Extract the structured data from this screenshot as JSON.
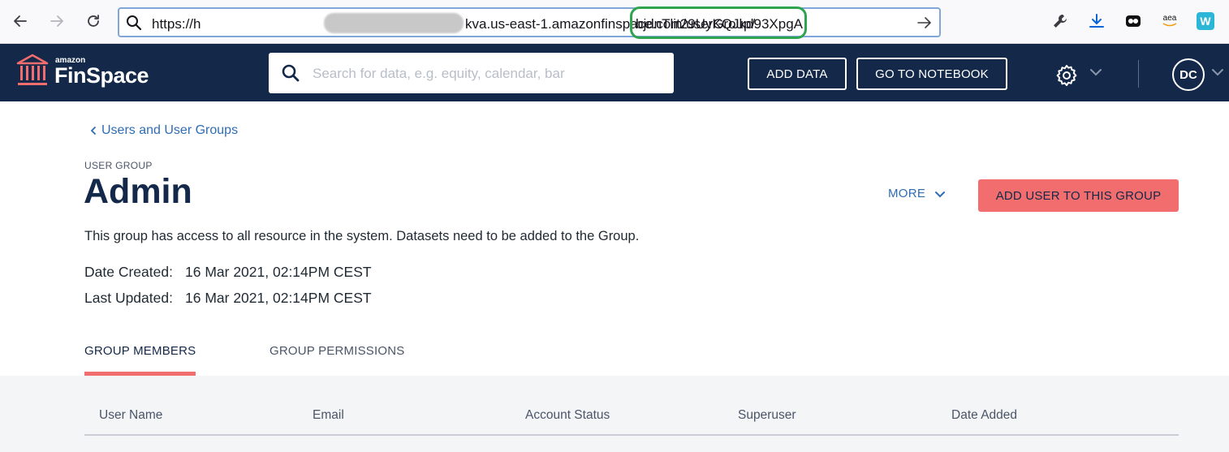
{
  "browser": {
    "url_prefix": "https://h",
    "url_middle": "kva.us-east-1.amazonfinspace.com/userGroup/",
    "url_highlight": "bjdnTlit29UyKQJkd93XpgA",
    "extensions": [
      "wrench-icon",
      "download-icon",
      "extension-icon",
      "amazon-assistant-icon",
      "w-extension-icon"
    ],
    "ext_aea_label": "aea",
    "ext_w_label": "W"
  },
  "header": {
    "logo_small": "amazon",
    "logo_big": "FinSpace",
    "search_placeholder": "Search for data, e.g. equity, calendar, bar",
    "add_data_label": "ADD DATA",
    "notebook_label": "GO TO NOTEBOOK",
    "avatar_initials": "DC"
  },
  "page": {
    "breadcrumb": "Users and User Groups",
    "section_label": "USER GROUP",
    "title": "Admin",
    "more_label": "MORE",
    "add_user_label": "ADD USER TO THIS GROUP",
    "description": "This group has access to all resource in the system. Datasets need to be added to the Group.",
    "date_created_label": "Date Created:",
    "date_created": "16 Mar 2021, 02:14PM CEST",
    "last_updated_label": "Last Updated:",
    "last_updated": "16 Mar 2021, 02:14PM CEST"
  },
  "tabs": [
    {
      "label": "GROUP MEMBERS",
      "active": true
    },
    {
      "label": "GROUP PERMISSIONS",
      "active": false
    }
  ],
  "table": {
    "columns": [
      "User Name",
      "Email",
      "Account Status",
      "Superuser",
      "Date Added"
    ]
  },
  "colors": {
    "header_bg": "#14294a",
    "accent": "#f26d6d",
    "link": "#2f6db5",
    "url_highlight": "#2ea44f"
  }
}
